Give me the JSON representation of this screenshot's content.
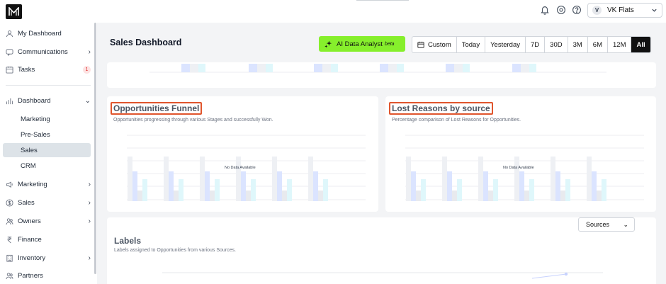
{
  "org": {
    "avatar_letter": "V",
    "name": "VK Flats"
  },
  "sidebar": {
    "items": [
      {
        "label": "My Dashboard"
      },
      {
        "label": "Communications"
      },
      {
        "label": "Tasks",
        "badge": "1"
      },
      {
        "label": "Dashboard"
      },
      {
        "label": "Marketing"
      },
      {
        "label": "Sales"
      },
      {
        "label": "Owners"
      },
      {
        "label": "Finance"
      },
      {
        "label": "Inventory"
      },
      {
        "label": "Partners"
      }
    ],
    "dashboard_sub": [
      "Marketing",
      "Pre-Sales",
      "Sales",
      "CRM"
    ]
  },
  "header": {
    "title": "Sales Dashboard",
    "ai_label": "AI Data Analyst",
    "ai_tag": "beta",
    "ranges": [
      "Custom",
      "Today",
      "Yesterday",
      "7D",
      "30D",
      "3M",
      "6M",
      "12M",
      "All"
    ],
    "active_range": "All"
  },
  "cards": {
    "funnel": {
      "title": "Opportunities Funnel",
      "subtitle": "Opportunities progressing through various Stages and successfully Won.",
      "empty": "No Data Available"
    },
    "lost": {
      "title": "Lost Reasons by source",
      "subtitle": "Percentage comparison of Lost Reasons for Opportunities.",
      "empty": "No Data Available"
    },
    "labels": {
      "title": "Labels",
      "subtitle": "Labels assigned to Opportunities from various Sources.",
      "dropdown": "Sources"
    }
  },
  "colors": {
    "accent_green": "#86ef2c",
    "highlight": "#e0552d",
    "active_nav": "#dde3e8"
  }
}
